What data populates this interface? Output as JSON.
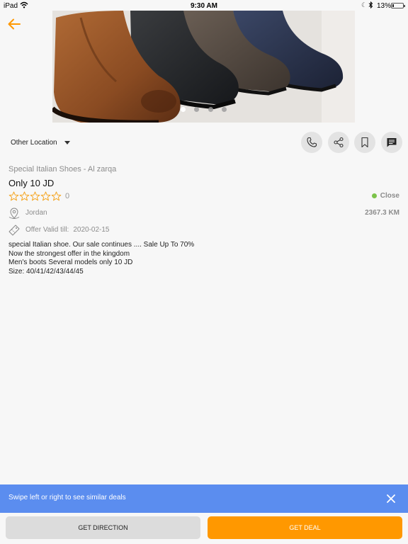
{
  "status_bar": {
    "device": "iPad",
    "time": "9:30 AM",
    "battery": "13%",
    "battery_level": 0.13
  },
  "hero": {
    "image": "boots-photo",
    "slides": 4,
    "active_slide": 1
  },
  "location": {
    "selected": "Other Location"
  },
  "actions": [
    "phone-icon",
    "share-icon",
    "bookmark-icon",
    "chat-icon"
  ],
  "deal": {
    "merchant": "Special Italian Shoes - Al zarqa",
    "title": "Only 10 JD",
    "rating": 0,
    "rating_count": "0",
    "status": "Close",
    "status_color": "#7cc34a",
    "country": "Jordan",
    "distance": "2367.3 KM",
    "valid_label": "Offer Valid till:",
    "valid_date": "2020-02-15",
    "description": [
      "special Italian shoe. Our sale continues .... Sale Up To 70%",
      "Now the strongest offer in the kingdom",
      "Men's boots Several models only 10 JD",
      "Size: 40/41/42/43/44/45"
    ]
  },
  "banner": {
    "text": "Swipe left or right to see similar deals",
    "color": "#5b8def"
  },
  "buttons": {
    "direction": "GET DIRECTION",
    "deal": "GET DEAL",
    "accent": "#ff9800"
  }
}
